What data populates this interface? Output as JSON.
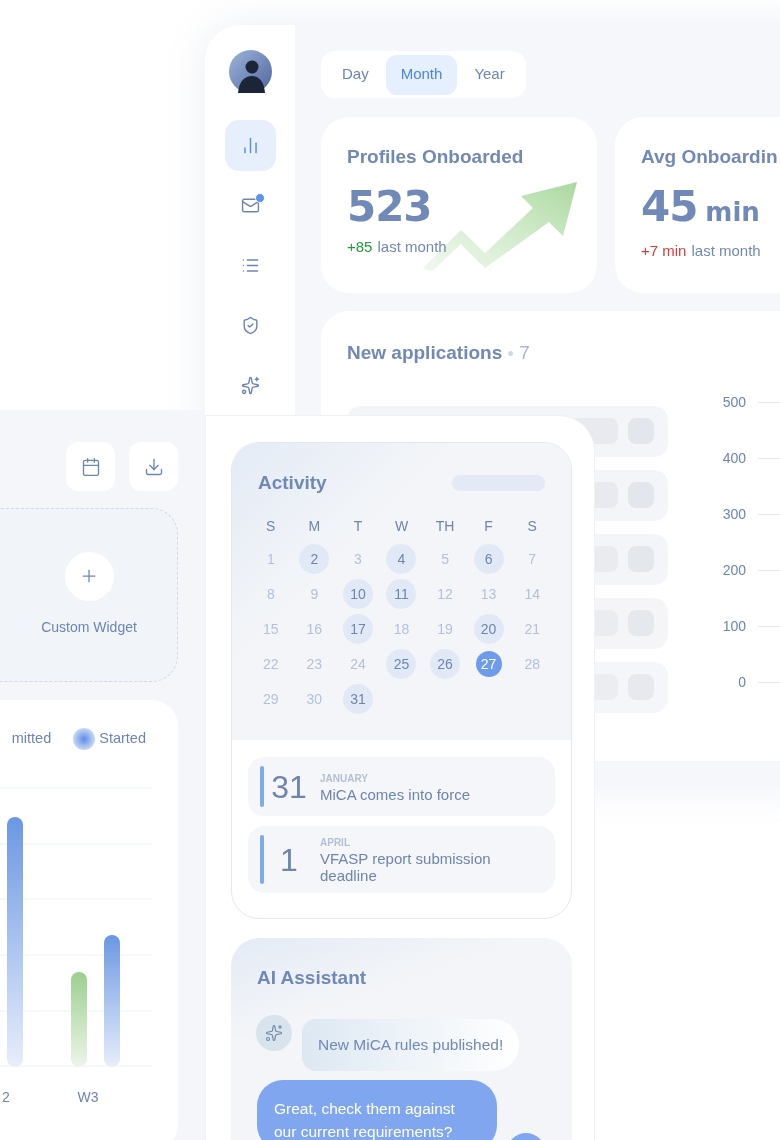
{
  "sidebar": {
    "items": [
      {
        "kind": "chart",
        "selected": true,
        "badge": false
      },
      {
        "kind": "mail",
        "selected": false,
        "badge": true
      },
      {
        "kind": "list",
        "selected": false,
        "badge": false
      },
      {
        "kind": "shield",
        "selected": false,
        "badge": false
      },
      {
        "kind": "sparkles",
        "selected": false,
        "badge": false
      }
    ]
  },
  "period_tabs": [
    {
      "label": "Day",
      "selected": false
    },
    {
      "label": "Month",
      "selected": true
    },
    {
      "label": "Year",
      "selected": false
    }
  ],
  "stats": [
    {
      "title": "Profiles Onboarded",
      "value": "523",
      "delta": "+85",
      "color": "#1f9d3a",
      "note": "last month",
      "trend_arrow": true
    },
    {
      "title": "Avg Onboardin",
      "value": "45",
      "unit": "min",
      "delta": "+7 min",
      "color": "#d93a3a",
      "note": "last month",
      "trend_arrow": false
    }
  ],
  "applications": {
    "title": "New applications",
    "count": "7",
    "y_labels": [
      "500",
      "400",
      "300",
      "200",
      "100",
      "0"
    ]
  },
  "toolbar": [
    {
      "kind": "calendar"
    },
    {
      "kind": "download"
    }
  ],
  "custom_widget": {
    "label": "Custom Widget"
  },
  "weekly_chart": {
    "legend": [
      {
        "label": "mitted",
        "dot": false
      },
      {
        "label": "Started",
        "dot": true
      }
    ],
    "x_labels": [
      "2",
      "W3"
    ]
  },
  "activity": {
    "title": "Activity",
    "weekdays": [
      "S",
      "M",
      "T",
      "W",
      "TH",
      "F",
      "S"
    ],
    "days": [
      {
        "label": "1",
        "marked": false,
        "selected": false
      },
      {
        "label": "2",
        "marked": true,
        "selected": false
      },
      {
        "label": "3",
        "marked": false,
        "selected": false
      },
      {
        "label": "4",
        "marked": true,
        "selected": false
      },
      {
        "label": "5",
        "marked": false,
        "selected": false
      },
      {
        "label": "6",
        "marked": true,
        "selected": false
      },
      {
        "label": "7",
        "marked": false,
        "selected": false
      },
      {
        "label": "8",
        "marked": false,
        "selected": false
      },
      {
        "label": "9",
        "marked": false,
        "selected": false
      },
      {
        "label": "10",
        "marked": true,
        "selected": false
      },
      {
        "label": "11",
        "marked": true,
        "selected": false
      },
      {
        "label": "12",
        "marked": false,
        "selected": false
      },
      {
        "label": "13",
        "marked": false,
        "selected": false
      },
      {
        "label": "14",
        "marked": false,
        "selected": false
      },
      {
        "label": "15",
        "marked": false,
        "selected": false
      },
      {
        "label": "16",
        "marked": false,
        "selected": false
      },
      {
        "label": "17",
        "marked": true,
        "selected": false
      },
      {
        "label": "18",
        "marked": false,
        "selected": false
      },
      {
        "label": "19",
        "marked": false,
        "selected": false
      },
      {
        "label": "20",
        "marked": true,
        "selected": false
      },
      {
        "label": "21",
        "marked": false,
        "selected": false
      },
      {
        "label": "22",
        "marked": false,
        "selected": false
      },
      {
        "label": "23",
        "marked": false,
        "selected": false
      },
      {
        "label": "24",
        "marked": false,
        "selected": false
      },
      {
        "label": "25",
        "marked": true,
        "selected": false
      },
      {
        "label": "26",
        "marked": true,
        "selected": false
      },
      {
        "label": "27",
        "marked": false,
        "selected": true
      },
      {
        "label": "28",
        "marked": false,
        "selected": false
      },
      {
        "label": "29",
        "marked": false,
        "selected": false
      },
      {
        "label": "30",
        "marked": false,
        "selected": false
      },
      {
        "label": "31",
        "marked": true,
        "selected": false
      }
    ],
    "events": [
      {
        "day": "31",
        "month": "JANUARY",
        "title": "MiCA comes into force"
      },
      {
        "day": "1",
        "month": "APRIL",
        "title": "VFASP report submission deadline"
      }
    ]
  },
  "assistant": {
    "title": "AI Assistant",
    "messages": [
      {
        "kind": "assistant",
        "text": "New MiCA rules published!"
      },
      {
        "kind": "user",
        "text": "Great, check them against our current requirements?"
      }
    ]
  }
}
